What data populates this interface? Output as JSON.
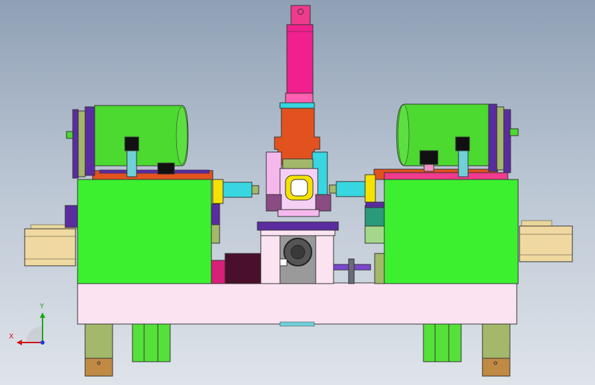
{
  "axes": {
    "x_label": "X",
    "y_label": "Y"
  },
  "colors": {
    "motor_green": "#4cd930",
    "block_green": "#3cf030",
    "base_pink": "#fbe3f2",
    "cylinder_magenta": "#f0208e",
    "orange": "#e2521f",
    "purple": "#5a2ca0",
    "olive": "#a3b86a",
    "cyan": "#37d6e0",
    "tan": "#f0d9a0",
    "yellow": "#f5e200"
  }
}
